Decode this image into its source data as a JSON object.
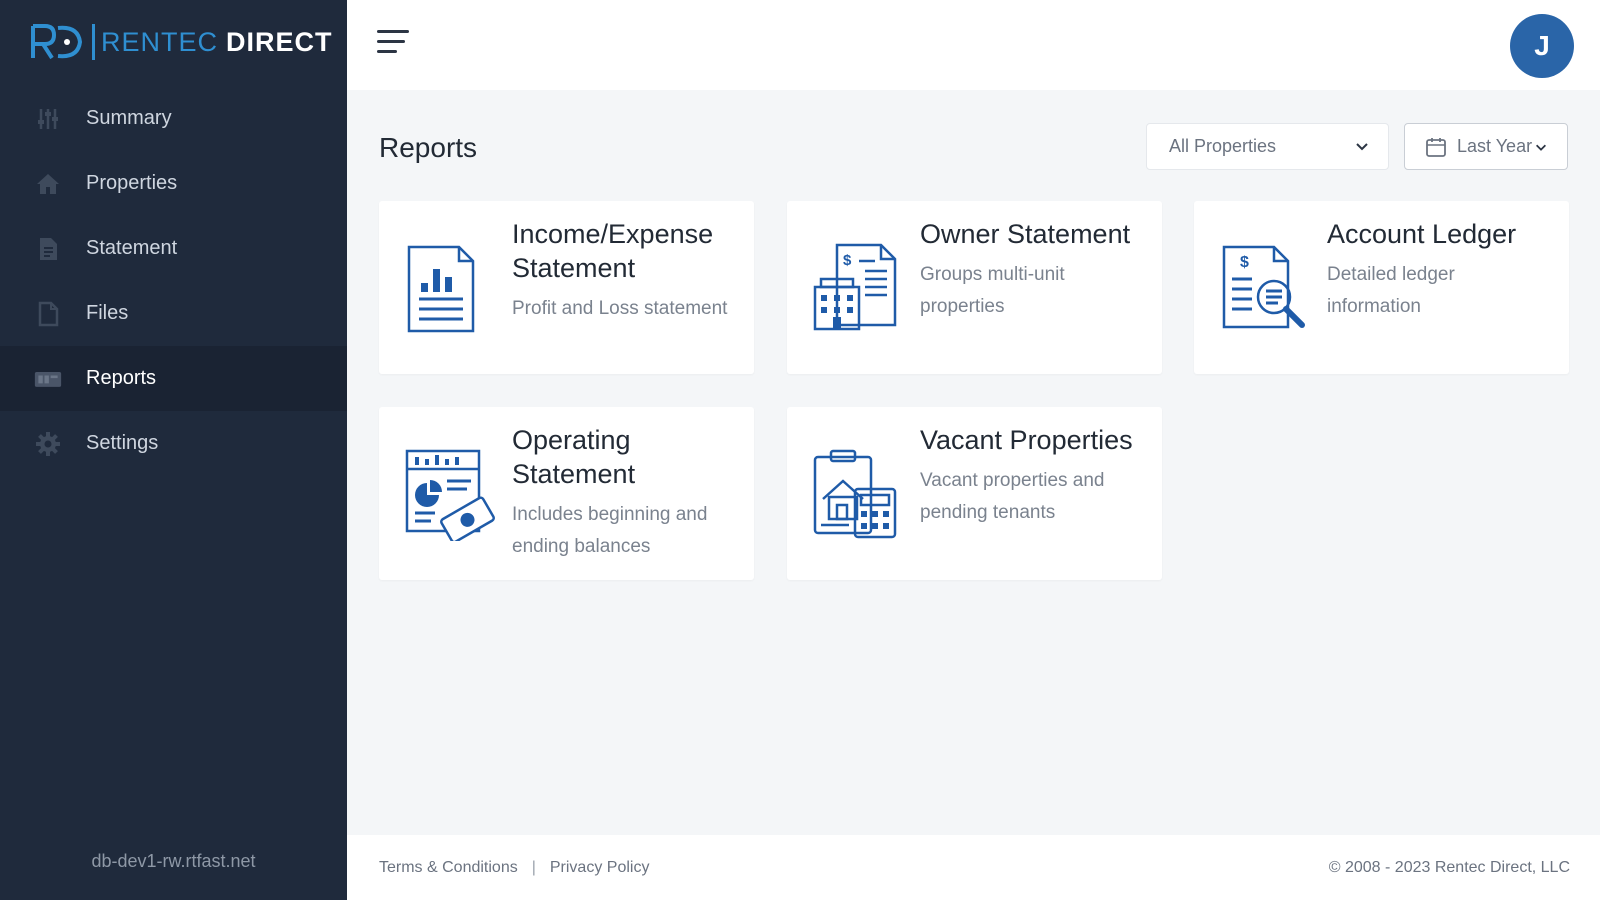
{
  "brand": {
    "rentec": "RENTEC",
    "direct": "DIRECT",
    "color": "#2f8fd1"
  },
  "sidebar": {
    "items": [
      {
        "label": "Summary",
        "icon": "sliders-icon",
        "active": false
      },
      {
        "label": "Properties",
        "icon": "home-icon",
        "active": false
      },
      {
        "label": "Statement",
        "icon": "document-icon",
        "active": false
      },
      {
        "label": "Files",
        "icon": "file-icon",
        "active": false
      },
      {
        "label": "Reports",
        "icon": "reports-icon",
        "active": true
      },
      {
        "label": "Settings",
        "icon": "gear-icon",
        "active": false
      }
    ],
    "server": "db-dev1-rw.rtfast.net"
  },
  "header": {
    "avatar_initial": "J",
    "avatar_color": "#2a65a8"
  },
  "main": {
    "title": "Reports",
    "property_filter": "All Properties",
    "date_filter": "Last Year",
    "cards": [
      {
        "title": "Income/Expense Statement",
        "desc": "Profit and Loss statement",
        "icon": "income-chart-icon"
      },
      {
        "title": "Owner Statement",
        "desc": "Groups multi-unit properties",
        "icon": "owner-building-icon"
      },
      {
        "title": "Account Ledger",
        "desc": "Detailed ledger information",
        "icon": "ledger-search-icon"
      },
      {
        "title": "Operating Statement",
        "desc": "Includes beginning and ending balances",
        "icon": "operating-cash-icon"
      },
      {
        "title": "Vacant Properties",
        "desc": "Vacant properties and pending tenants",
        "icon": "vacant-house-icon"
      }
    ]
  },
  "footer": {
    "terms": "Terms & Conditions",
    "separator": "|",
    "privacy": "Privacy Policy",
    "copyright": "© 2008 - 2023 Rentec Direct, LLC"
  }
}
